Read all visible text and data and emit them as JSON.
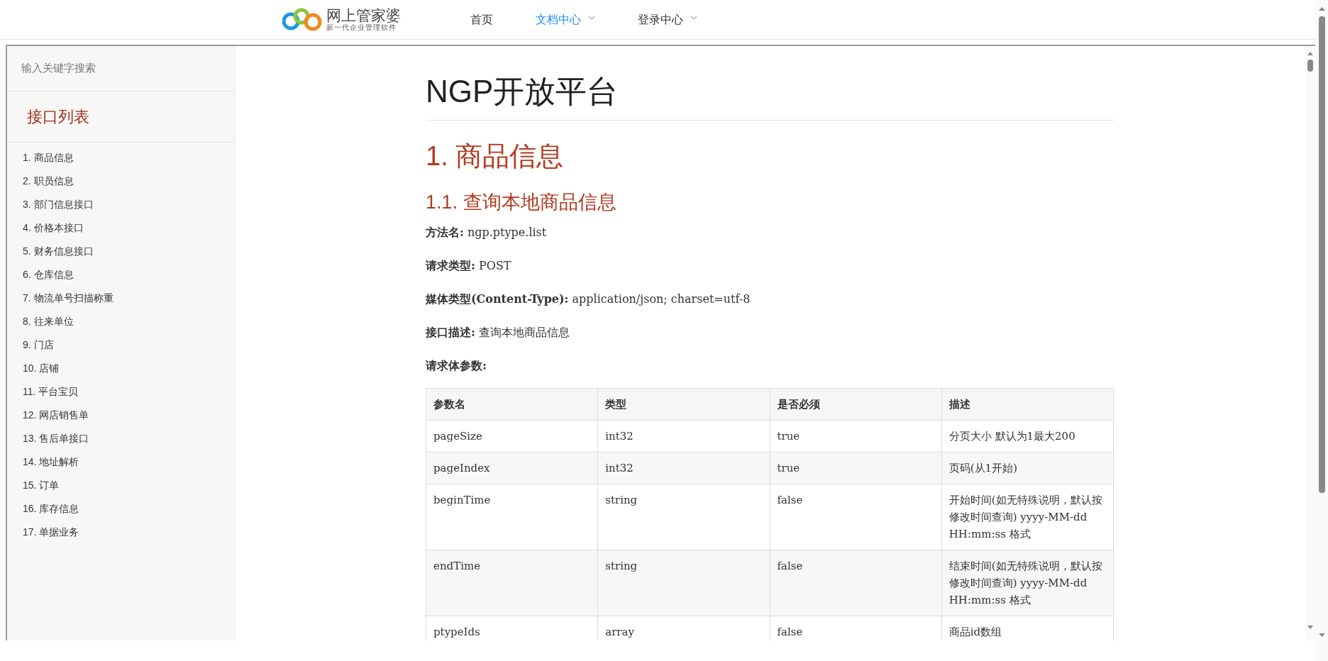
{
  "header": {
    "logo": {
      "name": "网上管家婆",
      "tagline": "新一代企业管理软件"
    },
    "nav": [
      {
        "label": "首页",
        "selected": false,
        "dropdown": false
      },
      {
        "label": "文档中心",
        "selected": true,
        "dropdown": true
      },
      {
        "label": "登录中心",
        "selected": false,
        "dropdown": true
      }
    ]
  },
  "sidebar": {
    "search": {
      "placeholder": "输入关键字搜索"
    },
    "title": "接口列表",
    "items": [
      "1. 商品信息",
      "2. 职员信息",
      "3. 部门信息接口",
      "4. 价格本接口",
      "5. 财务信息接口",
      "6. 仓库信息",
      "7. 物流单号扫描称重",
      "8. 往来单位",
      "9. 门店",
      "10. 店铺",
      "11. 平台宝贝",
      "12. 网店销售单",
      "13. 售后单接口",
      "14. 地址解析",
      "15. 订单",
      "16. 库存信息",
      "17. 单据业务"
    ]
  },
  "content": {
    "title": "NGP开放平台",
    "h1": "1. 商品信息",
    "h2": "1.1. 查询本地商品信息",
    "fields": [
      "**方法名:** ngp.ptype.list",
      "**请求类型:** POST",
      "**媒体类型(Content-Type):** application/json; charset=utf-8",
      "**接口描述:** 查询本地商品信息",
      "**请求体参数:**"
    ],
    "table": {
      "columns": [
        "参数名",
        "类型",
        "是否必须",
        "描述"
      ],
      "rows": [
        [
          "pageSize",
          "int32",
          "true",
          "分页大小 默认为1最大200"
        ],
        [
          "pageIndex",
          "int32",
          "true",
          "页码(从1开始)"
        ],
        [
          "beginTime",
          "string",
          "false",
          "开始时间(如无特殊说明，默认按修改时间查询) yyyy-MM-dd HH:mm:ss 格式"
        ],
        [
          "endTime",
          "string",
          "false",
          "结束时间(如无特殊说明，默认按修改时间查询) yyyy-MM-dd HH:mm:ss 格式"
        ],
        [
          "ptypeIds",
          "array",
          "false",
          "商品id数组"
        ]
      ]
    }
  }
}
